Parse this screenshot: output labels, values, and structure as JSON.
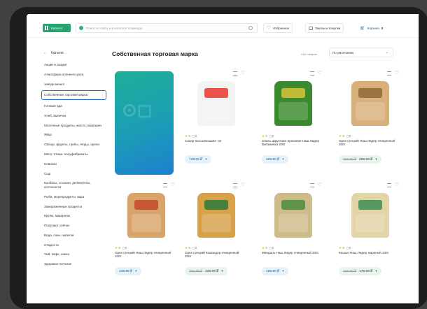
{
  "header": {
    "catalog_label": "Каталог",
    "search_placeholder": "Поиск по сайту и в каталоге Командор",
    "favorites_label": "Избранное",
    "orders_label": "Заказы и покупки",
    "cart_label": "Корзина",
    "cart_count": "0"
  },
  "sidebar": {
    "back_label": "Каталог",
    "items": [
      {
        "label": "Акции и скидки"
      },
      {
        "label": "Атмосфера осеннего уюта"
      },
      {
        "label": "заводи меню!"
      },
      {
        "label": "Собственная торговая марка"
      },
      {
        "label": "Готовая еда"
      },
      {
        "label": "Хлеб, выпечка"
      },
      {
        "label": "Молочные продукты, масло, маргарин"
      },
      {
        "label": "Яйцо"
      },
      {
        "label": "Овощи, фрукты, грибы, ягоды, орехи"
      },
      {
        "label": "Мясо, птица, полуфабрикаты"
      },
      {
        "label": "Новинки"
      },
      {
        "label": "Сыр"
      },
      {
        "label": "Колбасы, сосиски, деликатесы, копчености"
      },
      {
        "label": "Рыба, морепродукты, икра"
      },
      {
        "label": "Замороженные продукты"
      },
      {
        "label": "Крупы, макароны"
      },
      {
        "label": "Покупают сейчас"
      },
      {
        "label": "Вода, соки, напитки"
      },
      {
        "label": "Сладости"
      },
      {
        "label": "Чай, кофе, какао"
      },
      {
        "label": "Здоровое питание"
      }
    ]
  },
  "main": {
    "title": "Собственная торговая марка",
    "count": "216 товаров",
    "sort_label": "По умолчанию",
    "products": [
      {
        "name": "Сахар-песок Возьми! 1кг",
        "rating": "0",
        "reviews": "0",
        "price": "749.99 ₽"
      },
      {
        "name": "Смесь фруктово-ореховая Наш Лидер Витаминка 200г",
        "rating": "0",
        "reviews": "0",
        "price": "129.99 ₽"
      },
      {
        "name": "Орех грецкий Наш Лидер очищенный 300г",
        "rating": "0",
        "reviews": "0",
        "old_price": "369.99 ₽",
        "price": "299.99 ₽"
      },
      {
        "name": "Орех грецкий Наш Лидер очищенный 100г",
        "rating": "0",
        "reviews": "0",
        "price": "139.99 ₽"
      },
      {
        "name": "Орех грецкий Командор очищенный 200г",
        "rating": "0",
        "reviews": "0",
        "old_price": "289.99 ₽",
        "price": "229.99 ₽"
      },
      {
        "name": "Миндаль Наш Лидер очищенный 200г",
        "rating": "0",
        "reviews": "0",
        "price": "199.99 ₽"
      },
      {
        "name": "Кешью Наш Лидер жареный 100г",
        "rating": "0",
        "reviews": "0",
        "old_price": "199.99 ₽",
        "price": "179.99 ₽"
      }
    ]
  },
  "icons": {
    "catalog": "grid-icon",
    "search": "magnifier-icon",
    "favorites": "heart-icon",
    "orders": "box-icon",
    "cart": "cart-icon",
    "compare": "compare-icon",
    "wishlist": "heart-icon",
    "star": "star-icon"
  },
  "colors": {
    "accent": "#27a36f",
    "active_border": "#1d73c9",
    "price_bg": "#e6f2fa",
    "promo_bg": "#e7f5ec"
  }
}
